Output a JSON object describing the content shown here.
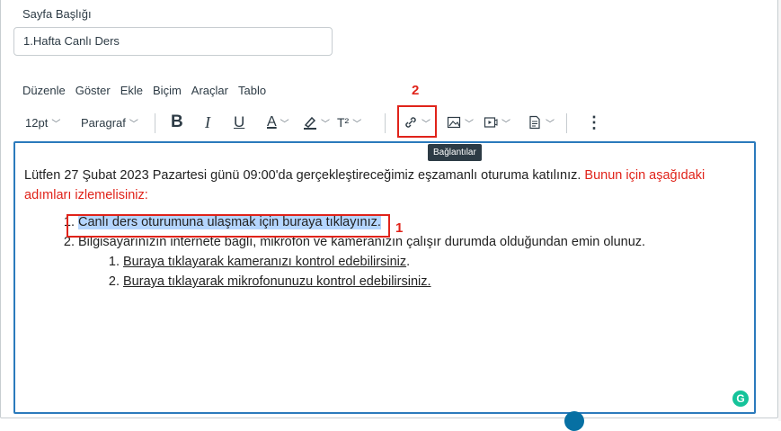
{
  "page_title": {
    "label": "Sayfa Başlığı",
    "value": "1.Hafta Canlı Ders"
  },
  "menubar": [
    "Düzenle",
    "Göster",
    "Ekle",
    "Biçim",
    "Araçlar",
    "Tablo"
  ],
  "toolbar": {
    "font_size": "12pt",
    "block_format": "Paragraf",
    "bold": "B",
    "italic": "I",
    "underline": "U",
    "text_color": "A",
    "superscript": "T²",
    "more": "⋮"
  },
  "tooltip": "Bağlantılar",
  "annotations": {
    "one": "1",
    "two": "2"
  },
  "content": {
    "intro_black": "Lütfen 27 Şubat 2023 Pazartesi günü 09:00'da gerçekleştireceğimiz eşzamanlı oturuma katılınız.",
    "intro_red": "Bunun için aşağıdaki adımları izlemelisiniz:",
    "item1": "Canlı ders oturumuna ulaşmak için buraya tıklayınız.",
    "item2": "Bilgisayarınızın internete bağlı, mikrofon ve kameranızın çalışır durumda olduğundan emin olunuz.",
    "sub1": "Buraya tıklayarak kameranızı kontrol edebilirsiniz",
    "sub1_end": ".",
    "sub2": "Buraya tıklayarak mikrofonunuzu kontrol edebilirsiniz."
  },
  "grammarly": "G",
  "colors": {
    "accent": "#2b7abc",
    "annotation_red": "#e0231a",
    "selection": "#b4d5fe"
  }
}
